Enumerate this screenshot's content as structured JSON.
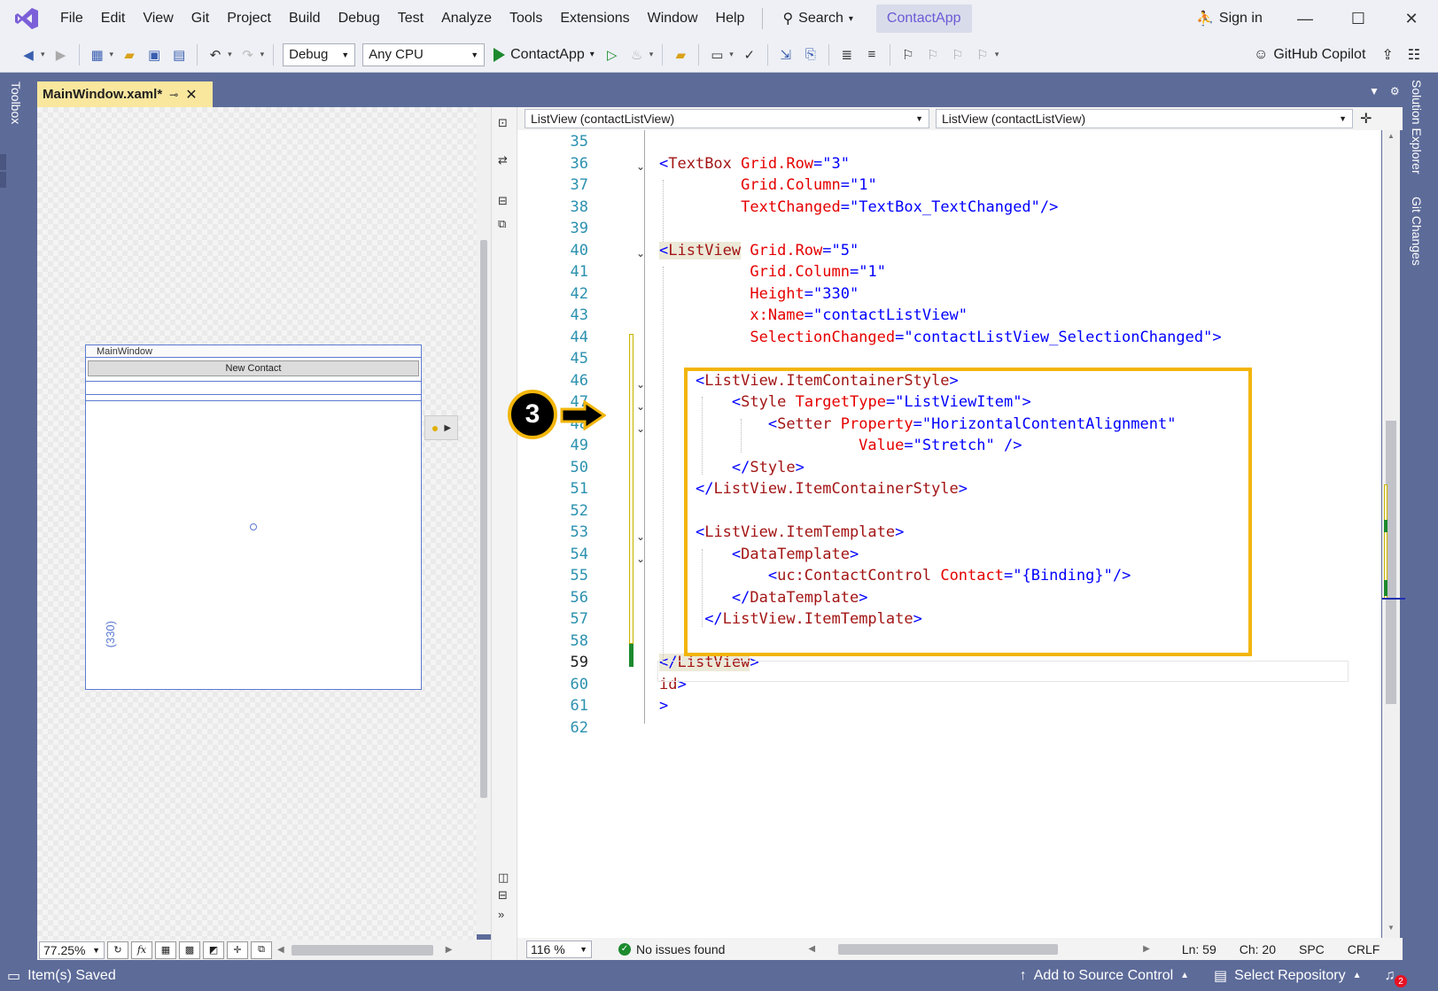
{
  "menu": {
    "items": [
      "File",
      "Edit",
      "View",
      "Git",
      "Project",
      "Build",
      "Debug",
      "Test",
      "Analyze",
      "Tools",
      "Extensions",
      "Window",
      "Help"
    ],
    "search_label": "Search",
    "app_title": "ContactApp",
    "sign_in": "Sign in"
  },
  "toolbar": {
    "config": "Debug",
    "platform": "Any CPU",
    "run_target": "ContactApp",
    "copilot": "GitHub Copilot"
  },
  "side_tabs": {
    "left": "Toolbox",
    "right_1": "Solution Explorer",
    "right_2": "Git Changes"
  },
  "document_tab": {
    "title": "MainWindow.xaml*"
  },
  "designer": {
    "window_title": "MainWindow",
    "button_label": "New Contact",
    "height_label": "(330)",
    "zoom": "77.25%",
    "fx_label": "fx"
  },
  "editor": {
    "nav_left": "ListView (contactListView)",
    "nav_right": "ListView (contactListView)",
    "zoom": "116 %",
    "issues": "No issues found",
    "ln": "Ln: 59",
    "ch": "Ch: 20",
    "spc": "SPC",
    "crlf": "CRLF",
    "callout_number": "3"
  },
  "code_lines": [
    {
      "n": "35",
      "parts": []
    },
    {
      "n": "36",
      "parts": [
        [
          "br",
          "<"
        ],
        [
          "tag",
          "TextBox"
        ],
        [
          "t",
          " "
        ],
        [
          "attr",
          "Grid.Row"
        ],
        [
          "br",
          "=\""
        ],
        [
          "val",
          "3"
        ],
        [
          "br",
          "\""
        ]
      ]
    },
    {
      "n": "37",
      "parts": [
        [
          "t",
          "         "
        ],
        [
          "attr",
          "Grid.Column"
        ],
        [
          "br",
          "=\""
        ],
        [
          "val",
          "1"
        ],
        [
          "br",
          "\""
        ]
      ]
    },
    {
      "n": "38",
      "parts": [
        [
          "t",
          "         "
        ],
        [
          "attr",
          "TextChanged"
        ],
        [
          "br",
          "=\""
        ],
        [
          "val",
          "TextBox_TextChanged"
        ],
        [
          "br",
          "\"/>"
        ]
      ]
    },
    {
      "n": "39",
      "parts": []
    },
    {
      "n": "40",
      "parts": [
        [
          "br",
          "<"
        ],
        [
          "tag",
          "ListView"
        ],
        [
          "t",
          " "
        ],
        [
          "attr",
          "Grid.Row"
        ],
        [
          "br",
          "=\""
        ],
        [
          "val",
          "5"
        ],
        [
          "br",
          "\""
        ]
      ]
    },
    {
      "n": "41",
      "parts": [
        [
          "t",
          "          "
        ],
        [
          "attr",
          "Grid.Column"
        ],
        [
          "br",
          "=\""
        ],
        [
          "val",
          "1"
        ],
        [
          "br",
          "\""
        ]
      ]
    },
    {
      "n": "42",
      "parts": [
        [
          "t",
          "          "
        ],
        [
          "attr",
          "Height"
        ],
        [
          "br",
          "=\""
        ],
        [
          "val",
          "330"
        ],
        [
          "br",
          "\""
        ]
      ]
    },
    {
      "n": "43",
      "parts": [
        [
          "t",
          "          "
        ],
        [
          "attr",
          "x:Name"
        ],
        [
          "br",
          "=\""
        ],
        [
          "val",
          "contactListView"
        ],
        [
          "br",
          "\""
        ]
      ]
    },
    {
      "n": "44",
      "parts": [
        [
          "t",
          "          "
        ],
        [
          "attr",
          "SelectionChanged"
        ],
        [
          "br",
          "=\""
        ],
        [
          "val",
          "contactListView_SelectionChanged"
        ],
        [
          "br",
          "\">"
        ]
      ]
    },
    {
      "n": "45",
      "parts": []
    },
    {
      "n": "46",
      "parts": [
        [
          "t",
          "    "
        ],
        [
          "br",
          "<"
        ],
        [
          "tag",
          "ListView.ItemContainerStyle"
        ],
        [
          "br",
          ">"
        ]
      ]
    },
    {
      "n": "47",
      "parts": [
        [
          "t",
          "        "
        ],
        [
          "br",
          "<"
        ],
        [
          "tag",
          "Style"
        ],
        [
          "t",
          " "
        ],
        [
          "attr",
          "TargetType"
        ],
        [
          "br",
          "=\""
        ],
        [
          "val",
          "ListViewItem"
        ],
        [
          "br",
          "\">"
        ]
      ]
    },
    {
      "n": "48",
      "parts": [
        [
          "t",
          "            "
        ],
        [
          "br",
          "<"
        ],
        [
          "tag",
          "Setter"
        ],
        [
          "t",
          " "
        ],
        [
          "attr",
          "Property"
        ],
        [
          "br",
          "=\""
        ],
        [
          "val",
          "HorizontalContentAlignment"
        ],
        [
          "br",
          "\""
        ]
      ]
    },
    {
      "n": "49",
      "parts": [
        [
          "t",
          "                      "
        ],
        [
          "attr",
          "Value"
        ],
        [
          "br",
          "=\""
        ],
        [
          "val",
          "Stretch"
        ],
        [
          "br",
          "\" />"
        ]
      ]
    },
    {
      "n": "50",
      "parts": [
        [
          "t",
          "        "
        ],
        [
          "br",
          "</"
        ],
        [
          "tag",
          "Style"
        ],
        [
          "br",
          ">"
        ]
      ]
    },
    {
      "n": "51",
      "parts": [
        [
          "t",
          "    "
        ],
        [
          "br",
          "</"
        ],
        [
          "tag",
          "ListView.ItemContainerStyle"
        ],
        [
          "br",
          ">"
        ]
      ]
    },
    {
      "n": "52",
      "parts": []
    },
    {
      "n": "53",
      "parts": [
        [
          "t",
          "    "
        ],
        [
          "br",
          "<"
        ],
        [
          "tag",
          "ListView.ItemTemplate"
        ],
        [
          "br",
          ">"
        ]
      ]
    },
    {
      "n": "54",
      "parts": [
        [
          "t",
          "        "
        ],
        [
          "br",
          "<"
        ],
        [
          "tag",
          "DataTemplate"
        ],
        [
          "br",
          ">"
        ]
      ]
    },
    {
      "n": "55",
      "parts": [
        [
          "t",
          "            "
        ],
        [
          "br",
          "<"
        ],
        [
          "tag",
          "uc:ContactControl"
        ],
        [
          "t",
          " "
        ],
        [
          "attr",
          "Contact"
        ],
        [
          "br",
          "=\""
        ],
        [
          "val",
          "{Binding}"
        ],
        [
          "br",
          "\"/>"
        ]
      ]
    },
    {
      "n": "56",
      "parts": [
        [
          "t",
          "        "
        ],
        [
          "br",
          "</"
        ],
        [
          "tag",
          "DataTemplate"
        ],
        [
          "br",
          ">"
        ]
      ]
    },
    {
      "n": "57",
      "parts": [
        [
          "t",
          "     "
        ],
        [
          "br",
          "</"
        ],
        [
          "tag",
          "ListView.ItemTemplate"
        ],
        [
          "br",
          ">"
        ]
      ]
    },
    {
      "n": "58",
      "parts": []
    },
    {
      "n": "59",
      "parts": [
        [
          "br",
          "</"
        ],
        [
          "tag",
          "ListView"
        ],
        [
          "br",
          ">"
        ]
      ]
    },
    {
      "n": "60",
      "parts": [
        [
          "tag",
          "id"
        ],
        [
          "br",
          ">"
        ]
      ]
    },
    {
      "n": "61",
      "parts": [
        [
          "br",
          ">"
        ]
      ]
    },
    {
      "n": "62",
      "parts": []
    }
  ],
  "statusbar": {
    "saved": "Item(s) Saved",
    "source_control": "Add to Source Control",
    "repository": "Select Repository",
    "notifications": "2"
  },
  "colors": {
    "accent": "#5d6b99",
    "highlight": "#f2b50a",
    "tab_active": "#f9e79e"
  }
}
